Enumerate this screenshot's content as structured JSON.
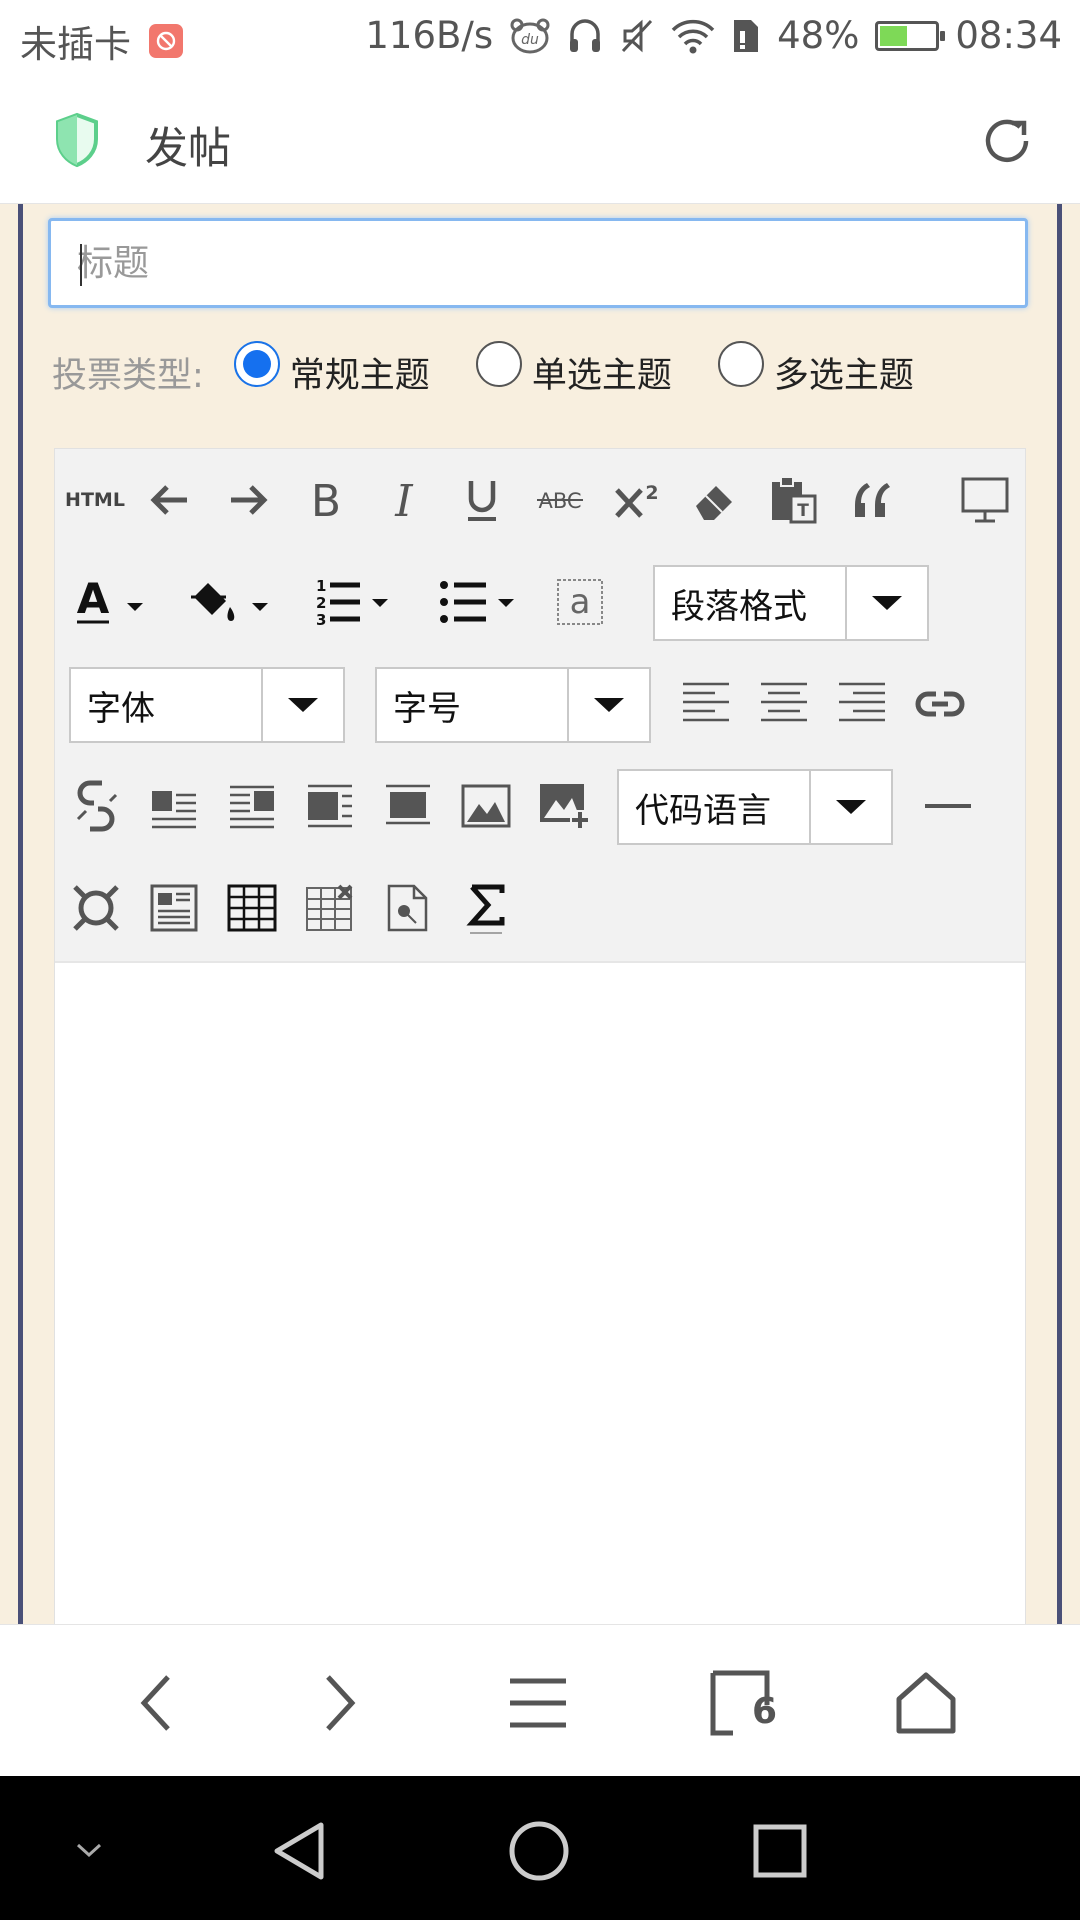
{
  "status_bar": {
    "carrier": "未插卡",
    "speed": "116B/s",
    "battery_pct": "48%",
    "battery_level": 0.48,
    "time": "08:34"
  },
  "app_bar": {
    "title": "发帖"
  },
  "form": {
    "title_placeholder": "标题",
    "vote_label": "投票类型:",
    "vote_options": [
      {
        "label": "常规主题",
        "checked": true
      },
      {
        "label": "单选主题",
        "checked": false
      },
      {
        "label": "多选主题",
        "checked": false
      }
    ]
  },
  "editor": {
    "html_label": "HTML",
    "paragraph_label": "段落格式",
    "font_label": "字体",
    "size_label": "字号",
    "code_lang_label": "代码语言"
  },
  "browser_nav": {
    "tab_count": "6"
  },
  "colors": {
    "page_bg": "#f8efdf",
    "accent": "#1570ef",
    "rail": "#4a5078"
  }
}
